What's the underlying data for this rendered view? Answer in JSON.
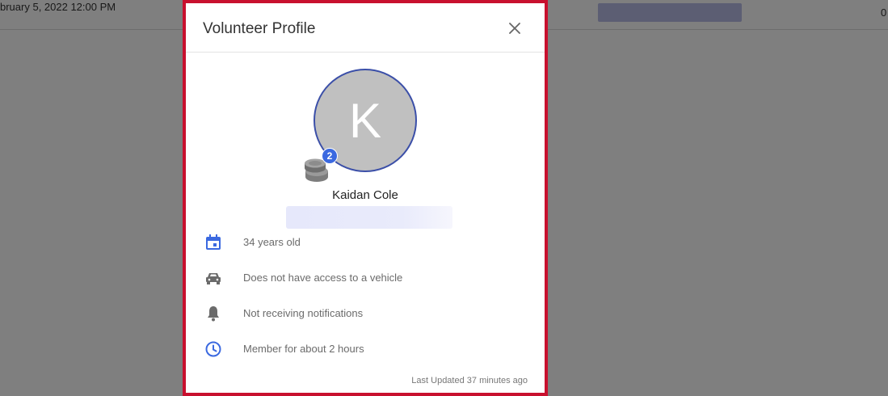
{
  "background": {
    "date_text": "bruary 5, 2022 12:00 PM",
    "trailing_number": "0"
  },
  "modal": {
    "title": "Volunteer Profile",
    "close_icon": "close-icon"
  },
  "profile": {
    "avatar_initial": "K",
    "badge_count": "2",
    "name": "Kaidan Cole",
    "info": [
      {
        "icon": "calendar-icon",
        "text": "34 years old",
        "color": "#3b69e0"
      },
      {
        "icon": "car-icon",
        "text": "Does not have access to a vehicle",
        "color": "#6b6b6b"
      },
      {
        "icon": "bell-icon",
        "text": "Not receiving notifications",
        "color": "#6b6b6b"
      },
      {
        "icon": "clock-icon",
        "text": "Member for about 2 hours",
        "color": "#3b69e0"
      }
    ],
    "last_updated": "Last Updated 37 minutes ago"
  },
  "colors": {
    "modal_border": "#c8102e",
    "avatar_border": "#3b4fa8",
    "badge": "#3b69e0"
  }
}
